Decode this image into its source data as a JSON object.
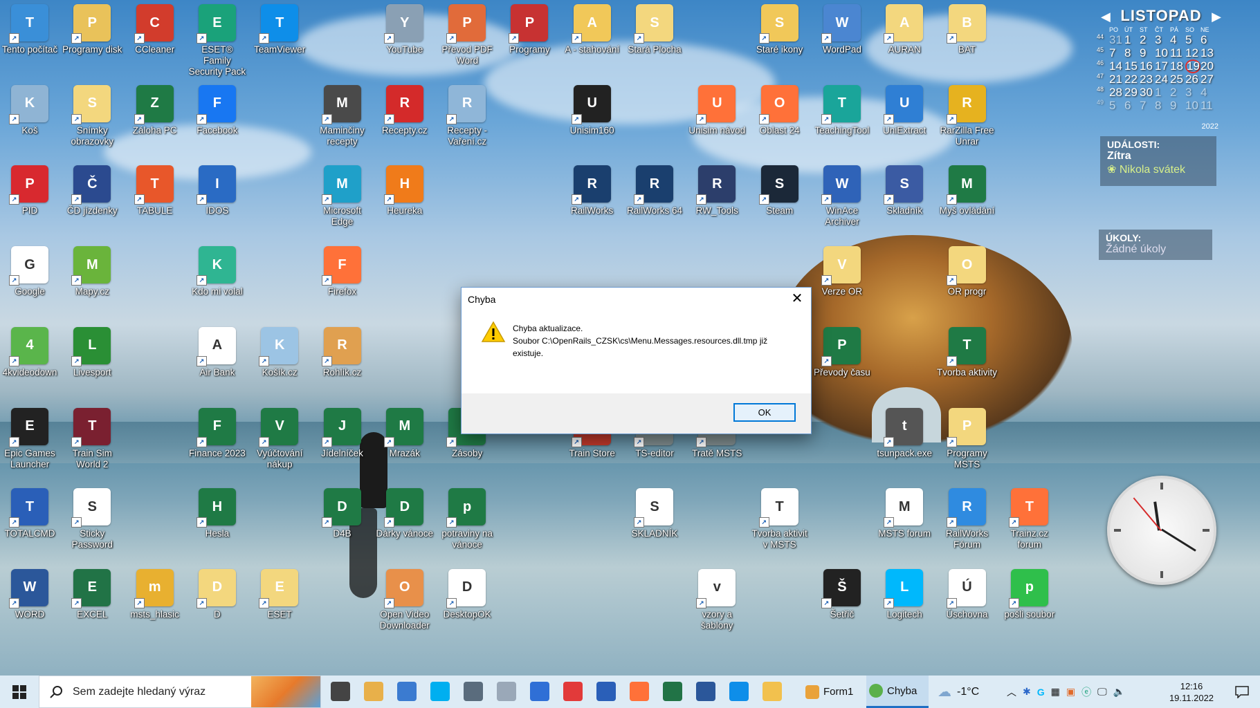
{
  "desktop_icons": [
    {
      "label": "Tento počítač",
      "icon": "computer-icon",
      "color": "#3a8fd8"
    },
    {
      "label": "Programy disk",
      "icon": "folder-disk-icon",
      "color": "#e9c25a"
    },
    {
      "label": "CCleaner",
      "icon": "ccleaner-icon",
      "color": "#d23c2c"
    },
    {
      "label": "ESET® Family Security Pack",
      "icon": "eset-icon",
      "color": "#1aa27a"
    },
    {
      "label": "TeamViewer",
      "icon": "teamviewer-icon",
      "color": "#0e8ee9"
    },
    {
      "label": "YouTube",
      "icon": "cd-drive-icon",
      "color": "#8aa0b4"
    },
    {
      "label": "Převod PDF Word",
      "icon": "pdf-word-icon",
      "color": "#e16b3a"
    },
    {
      "label": "Programy",
      "icon": "book-icon",
      "color": "#c73232"
    },
    {
      "label": "A - stahování",
      "icon": "folder-icon",
      "color": "#f1c859"
    },
    {
      "label": "Stará Plocha",
      "icon": "folder-icon",
      "color": "#f3d77e"
    },
    {
      "label": "Staré ikony",
      "icon": "folder-icon",
      "color": "#f1c859"
    },
    {
      "label": "WordPad",
      "icon": "wordpad-icon",
      "color": "#4b86d1"
    },
    {
      "label": "AURAN",
      "icon": "folder-icon",
      "color": "#f3d77e"
    },
    {
      "label": "BAT",
      "icon": "folder-icon",
      "color": "#f3d77e"
    },
    {
      "label": "Koš",
      "icon": "recycle-bin-icon",
      "color": "#8fb4d4"
    },
    {
      "label": "Snímky obrazovky",
      "icon": "folder-icon",
      "color": "#f3d77e"
    },
    {
      "label": "Záloha PC",
      "icon": "excel-file-icon",
      "color": "#1f7a45"
    },
    {
      "label": "Facebook",
      "icon": "facebook-icon",
      "color": "#1877f2"
    },
    {
      "label": "Maminčiny recepty",
      "icon": "pot-icon",
      "color": "#4a4a4a"
    },
    {
      "label": "Recepty.cz",
      "icon": "chef-icon",
      "color": "#d42a2a"
    },
    {
      "label": "Recepty - Vaření.cz",
      "icon": "magnifier-file-icon",
      "color": "#8fb6d8"
    },
    {
      "label": "Unisim160",
      "icon": "terminal-icon",
      "color": "#222222"
    },
    {
      "label": "Unisim návod",
      "icon": "firefox-icon",
      "color": "#ff7139"
    },
    {
      "label": "Oblast 24",
      "icon": "firefox-icon",
      "color": "#ff7139"
    },
    {
      "label": "TeachingTool",
      "icon": "teaching-tool-icon",
      "color": "#1aa59a"
    },
    {
      "label": "UniExtract",
      "icon": "uniextract-icon",
      "color": "#2f7fd4"
    },
    {
      "label": "RarZilla Free Unrar",
      "icon": "rarzilla-icon",
      "color": "#e6b21f"
    },
    {
      "label": "PID",
      "icon": "pid-icon",
      "color": "#d8292f"
    },
    {
      "label": "ČD jízdenky",
      "icon": "cd-ticket-icon",
      "color": "#2b4a8f"
    },
    {
      "label": "TABULE",
      "icon": "tabule-icon",
      "color": "#e8572a"
    },
    {
      "label": "IDOS",
      "icon": "idos-icon",
      "color": "#2a6bc4"
    },
    {
      "label": "Microsoft Edge",
      "icon": "edge-icon",
      "color": "#1fa0c9"
    },
    {
      "label": "Heureka",
      "icon": "heureka-icon",
      "color": "#f07b1a"
    },
    {
      "label": "RailWorks",
      "icon": "railworks-icon",
      "color": "#1a3f6e"
    },
    {
      "label": "RailWorks 64",
      "icon": "railworks-icon",
      "color": "#1a3f6e"
    },
    {
      "label": "RW_Tools",
      "icon": "rw-tools-icon",
      "color": "#2c3e6b"
    },
    {
      "label": "Steam",
      "icon": "steam-icon",
      "color": "#1b2838"
    },
    {
      "label": "WinAce Archiver",
      "icon": "winace-icon",
      "color": "#2f63b8"
    },
    {
      "label": "Skladník",
      "icon": "skladnik-icon",
      "color": "#3b5ba3"
    },
    {
      "label": "Myš ovládání",
      "icon": "excel-file-icon",
      "color": "#1f7a45"
    },
    {
      "label": "Google",
      "icon": "google-icon",
      "color": "#ffffff"
    },
    {
      "label": "Mapy.cz",
      "icon": "mapy-icon",
      "color": "#6ab43b"
    },
    {
      "label": "Kdo mi volal",
      "icon": "phone-question-icon",
      "color": "#2fb592"
    },
    {
      "label": "Firefox",
      "icon": "firefox-icon",
      "color": "#ff7139"
    },
    {
      "label": "Verze OR",
      "icon": "folder-icon",
      "color": "#f3d77e"
    },
    {
      "label": "OR progr",
      "icon": "folder-icon",
      "color": "#f3d77e"
    },
    {
      "label": "4kvideodown",
      "icon": "video-download-icon",
      "color": "#5ab54b"
    },
    {
      "label": "Livesport",
      "icon": "livesport-icon",
      "color": "#2a8f35"
    },
    {
      "label": "Air Bank",
      "icon": "airbank-icon",
      "color": "#ffffff"
    },
    {
      "label": "Košík.cz",
      "icon": "magnifier-icon",
      "color": "#9cc4e4"
    },
    {
      "label": "Rohlík.cz",
      "icon": "people-icon",
      "color": "#e0a050"
    },
    {
      "label": "Převody času",
      "icon": "excel-file-icon",
      "color": "#1f7a45"
    },
    {
      "label": "Tvorba aktivity",
      "icon": "excel-file-icon",
      "color": "#1f7a45"
    },
    {
      "label": "Epic Games Launcher",
      "icon": "epic-games-icon",
      "color": "#222222"
    },
    {
      "label": "Train Sim World 2",
      "icon": "train-sim-icon",
      "color": "#7a2030"
    },
    {
      "label": "Finance 2023",
      "icon": "excel-file-icon",
      "color": "#1f7a45"
    },
    {
      "label": "Vyúčtování nákup",
      "icon": "excel-file-icon",
      "color": "#1f7a45"
    },
    {
      "label": "Jídelníček",
      "icon": "excel-file-icon",
      "color": "#1f7a45"
    },
    {
      "label": "Mrazák",
      "icon": "excel-file-icon",
      "color": "#1f7a45"
    },
    {
      "label": "Zásoby",
      "icon": "excel-file-icon",
      "color": "#1f7a45"
    },
    {
      "label": "Train Store",
      "icon": "train-store-icon",
      "color": "#c0392b"
    },
    {
      "label": "TS-editor",
      "icon": "ts-editor-icon",
      "color": "#7f8c8d"
    },
    {
      "label": "Tratě MSTS",
      "icon": "msts-icon",
      "color": "#7f8c8d"
    },
    {
      "label": "tsunpack.exe",
      "icon": "tsunpack-icon",
      "color": "#555555"
    },
    {
      "label": "Programy MSTS",
      "icon": "folder-icon",
      "color": "#f3d77e"
    },
    {
      "label": "TOTALCMD",
      "icon": "totalcmd-icon",
      "color": "#2a5fb8"
    },
    {
      "label": "Sticky Password",
      "icon": "sticky-password-icon",
      "color": "#ffffff"
    },
    {
      "label": "Hesla",
      "icon": "excel-file-icon",
      "color": "#1f7a45"
    },
    {
      "label": "D4B",
      "icon": "excel-file-icon",
      "color": "#1f7a45"
    },
    {
      "label": "Dárky vánoce",
      "icon": "excel-file-icon",
      "color": "#1f7a45"
    },
    {
      "label": "potraviny na vánoce",
      "icon": "excel-file-icon",
      "color": "#1f7a45"
    },
    {
      "label": "SKLADNÍK",
      "icon": "skladnik-game-icon",
      "color": "#ffffff"
    },
    {
      "label": "Tvorba aktivit v MSTS",
      "icon": "msts-activity-icon",
      "color": "#ffffff"
    },
    {
      "label": "MSTS forum",
      "icon": "text-file-icon",
      "color": "#ffffff"
    },
    {
      "label": "RailWorks Fórum",
      "icon": "railworks-forum-icon",
      "color": "#2f8be0"
    },
    {
      "label": "Trainz.cz forum",
      "icon": "firefox-icon",
      "color": "#ff7139"
    },
    {
      "label": "WORD",
      "icon": "word-icon",
      "color": "#2b579a"
    },
    {
      "label": "EXCEL",
      "icon": "excel-icon",
      "color": "#217346"
    },
    {
      "label": "msts_hlasic",
      "icon": "msts-hlasic-icon",
      "color": "#e8b030"
    },
    {
      "label": "D",
      "icon": "folder-icon",
      "color": "#f3d77e"
    },
    {
      "label": "ESET",
      "icon": "eset-folder-icon",
      "color": "#f3d77e"
    },
    {
      "label": "Open Video Downloader",
      "icon": "video-download-icon",
      "color": "#e8904a"
    },
    {
      "label": "DesktopOK",
      "icon": "desktopok-icon",
      "color": "#ffffff"
    },
    {
      "label": "vzory a šablony",
      "icon": "word-file-icon",
      "color": "#ffffff"
    },
    {
      "label": "Šetřič",
      "icon": "screensaver-icon",
      "color": "#222222"
    },
    {
      "label": "Logitech",
      "icon": "logitech-icon",
      "color": "#00b8fc"
    },
    {
      "label": "Úschovna",
      "icon": "uschovna-icon",
      "color": "#ffffff"
    },
    {
      "label": "pošli soubor",
      "icon": "send-file-icon",
      "color": "#2fbf4b"
    }
  ],
  "calendar": {
    "month": "LISTOPAD",
    "year": "2022",
    "weekdays": [
      "PO",
      "ÚT",
      "ST",
      "ČT",
      "PÁ",
      "SO",
      "NE"
    ],
    "weeks": [
      [
        "44",
        "31",
        "1",
        "2",
        "3",
        "4",
        "5",
        "6"
      ],
      [
        "45",
        "7",
        "8",
        "9",
        "10",
        "11",
        "12",
        "13"
      ],
      [
        "46",
        "14",
        "15",
        "16",
        "17",
        "18",
        "19",
        "20"
      ],
      [
        "47",
        "21",
        "22",
        "23",
        "24",
        "25",
        "26",
        "27"
      ],
      [
        "48",
        "28",
        "29",
        "30",
        "1",
        "2",
        "3",
        "4"
      ],
      [
        "49",
        "5",
        "6",
        "7",
        "8",
        "9",
        "10",
        "11"
      ]
    ]
  },
  "events": {
    "heading": "UDÁLOSTI:",
    "day": "Zítra",
    "item": "Nikola svátek"
  },
  "tasks": {
    "heading": "ÚKOLY:",
    "item": "Žádné úkoly"
  },
  "dialog": {
    "title": "Chyba",
    "line1": "Chyba aktualizace.",
    "line2": "Soubor C:\\OpenRails_CZSK\\cs\\Menu.Messages.resources.dll.tmp již existuje.",
    "ok_label": "OK"
  },
  "taskbar": {
    "search_placeholder": "Sem zadejte hledaný výraz",
    "apps": [
      {
        "name": "task-view-icon",
        "color": "#444444"
      },
      {
        "name": "files-app-icon",
        "color": "#e8b04a"
      },
      {
        "name": "network-pc-icon",
        "color": "#3b7bd0"
      },
      {
        "name": "skype-icon",
        "color": "#00aff0"
      },
      {
        "name": "calculator-icon",
        "color": "#5a6c7d"
      },
      {
        "name": "keyboard-tool-icon",
        "color": "#9aa8b8"
      },
      {
        "name": "store-icon",
        "color": "#2f6fd6"
      },
      {
        "name": "sticky-password-icon",
        "color": "#e23a3a"
      },
      {
        "name": "totalcmd-icon",
        "color": "#2a5fb8"
      },
      {
        "name": "firefox-icon",
        "color": "#ff7139"
      },
      {
        "name": "excel-icon",
        "color": "#217346"
      },
      {
        "name": "word-icon",
        "color": "#2b579a"
      },
      {
        "name": "teamviewer-icon",
        "color": "#0e8ee9"
      },
      {
        "name": "explorer-icon",
        "color": "#f2c14e"
      }
    ],
    "form1_label": "Form1",
    "chyba_label": "Chyba",
    "weather": "-1°C",
    "time": "12:16",
    "date": "19.11.2022"
  }
}
